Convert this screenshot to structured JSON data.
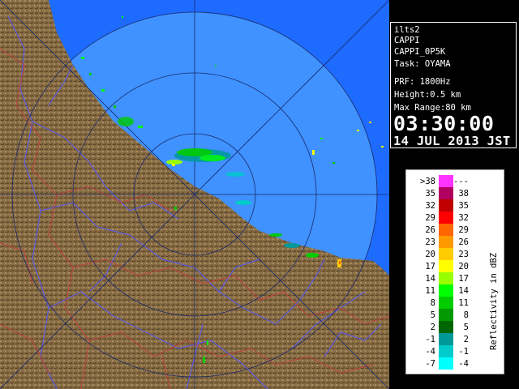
{
  "info": {
    "site": "ilts2",
    "product": "CAPPI",
    "product_name": "CAPPI_0P5K",
    "task": "Task: OYAMA",
    "prf": "PRF: 1800Hz",
    "height": "Height:0.5 km",
    "max_range": "Max Range:80 km",
    "time": "03:30:00",
    "date": "14 JUL 2013 JST"
  },
  "legend": {
    "title": "Reflectivity in dBZ",
    "bins": [
      {
        "low": ">38",
        "high": "---",
        "color": "#ff33ff"
      },
      {
        "low": "35",
        "high": "38",
        "color": "#b00060"
      },
      {
        "low": "32",
        "high": "35",
        "color": "#c00000"
      },
      {
        "low": "29",
        "high": "32",
        "color": "#ff0000"
      },
      {
        "low": "26",
        "high": "29",
        "color": "#ff6600"
      },
      {
        "low": "23",
        "high": "26",
        "color": "#ff9900"
      },
      {
        "low": "20",
        "high": "23",
        "color": "#ffcc00"
      },
      {
        "low": "17",
        "high": "20",
        "color": "#ffff00"
      },
      {
        "low": "14",
        "high": "17",
        "color": "#99ff00"
      },
      {
        "low": "11",
        "high": "14",
        "color": "#00ff00"
      },
      {
        "low": "8",
        "high": "11",
        "color": "#00cc00"
      },
      {
        "low": "5",
        "high": "8",
        "color": "#009900"
      },
      {
        "low": "2",
        "high": "5",
        "color": "#006600"
      },
      {
        "low": "-1",
        "high": "2",
        "color": "#009999"
      },
      {
        "low": "-4",
        "high": "-1",
        "color": "#00cccc"
      },
      {
        "low": "-7",
        "high": "-4",
        "color": "#00ffff"
      }
    ]
  },
  "colors": {
    "sea": "#1e6bff",
    "radar_coverage": "#3f92ff",
    "land": "#8a7048",
    "rivers": "#5a5ae0",
    "borders": "#c04040"
  }
}
